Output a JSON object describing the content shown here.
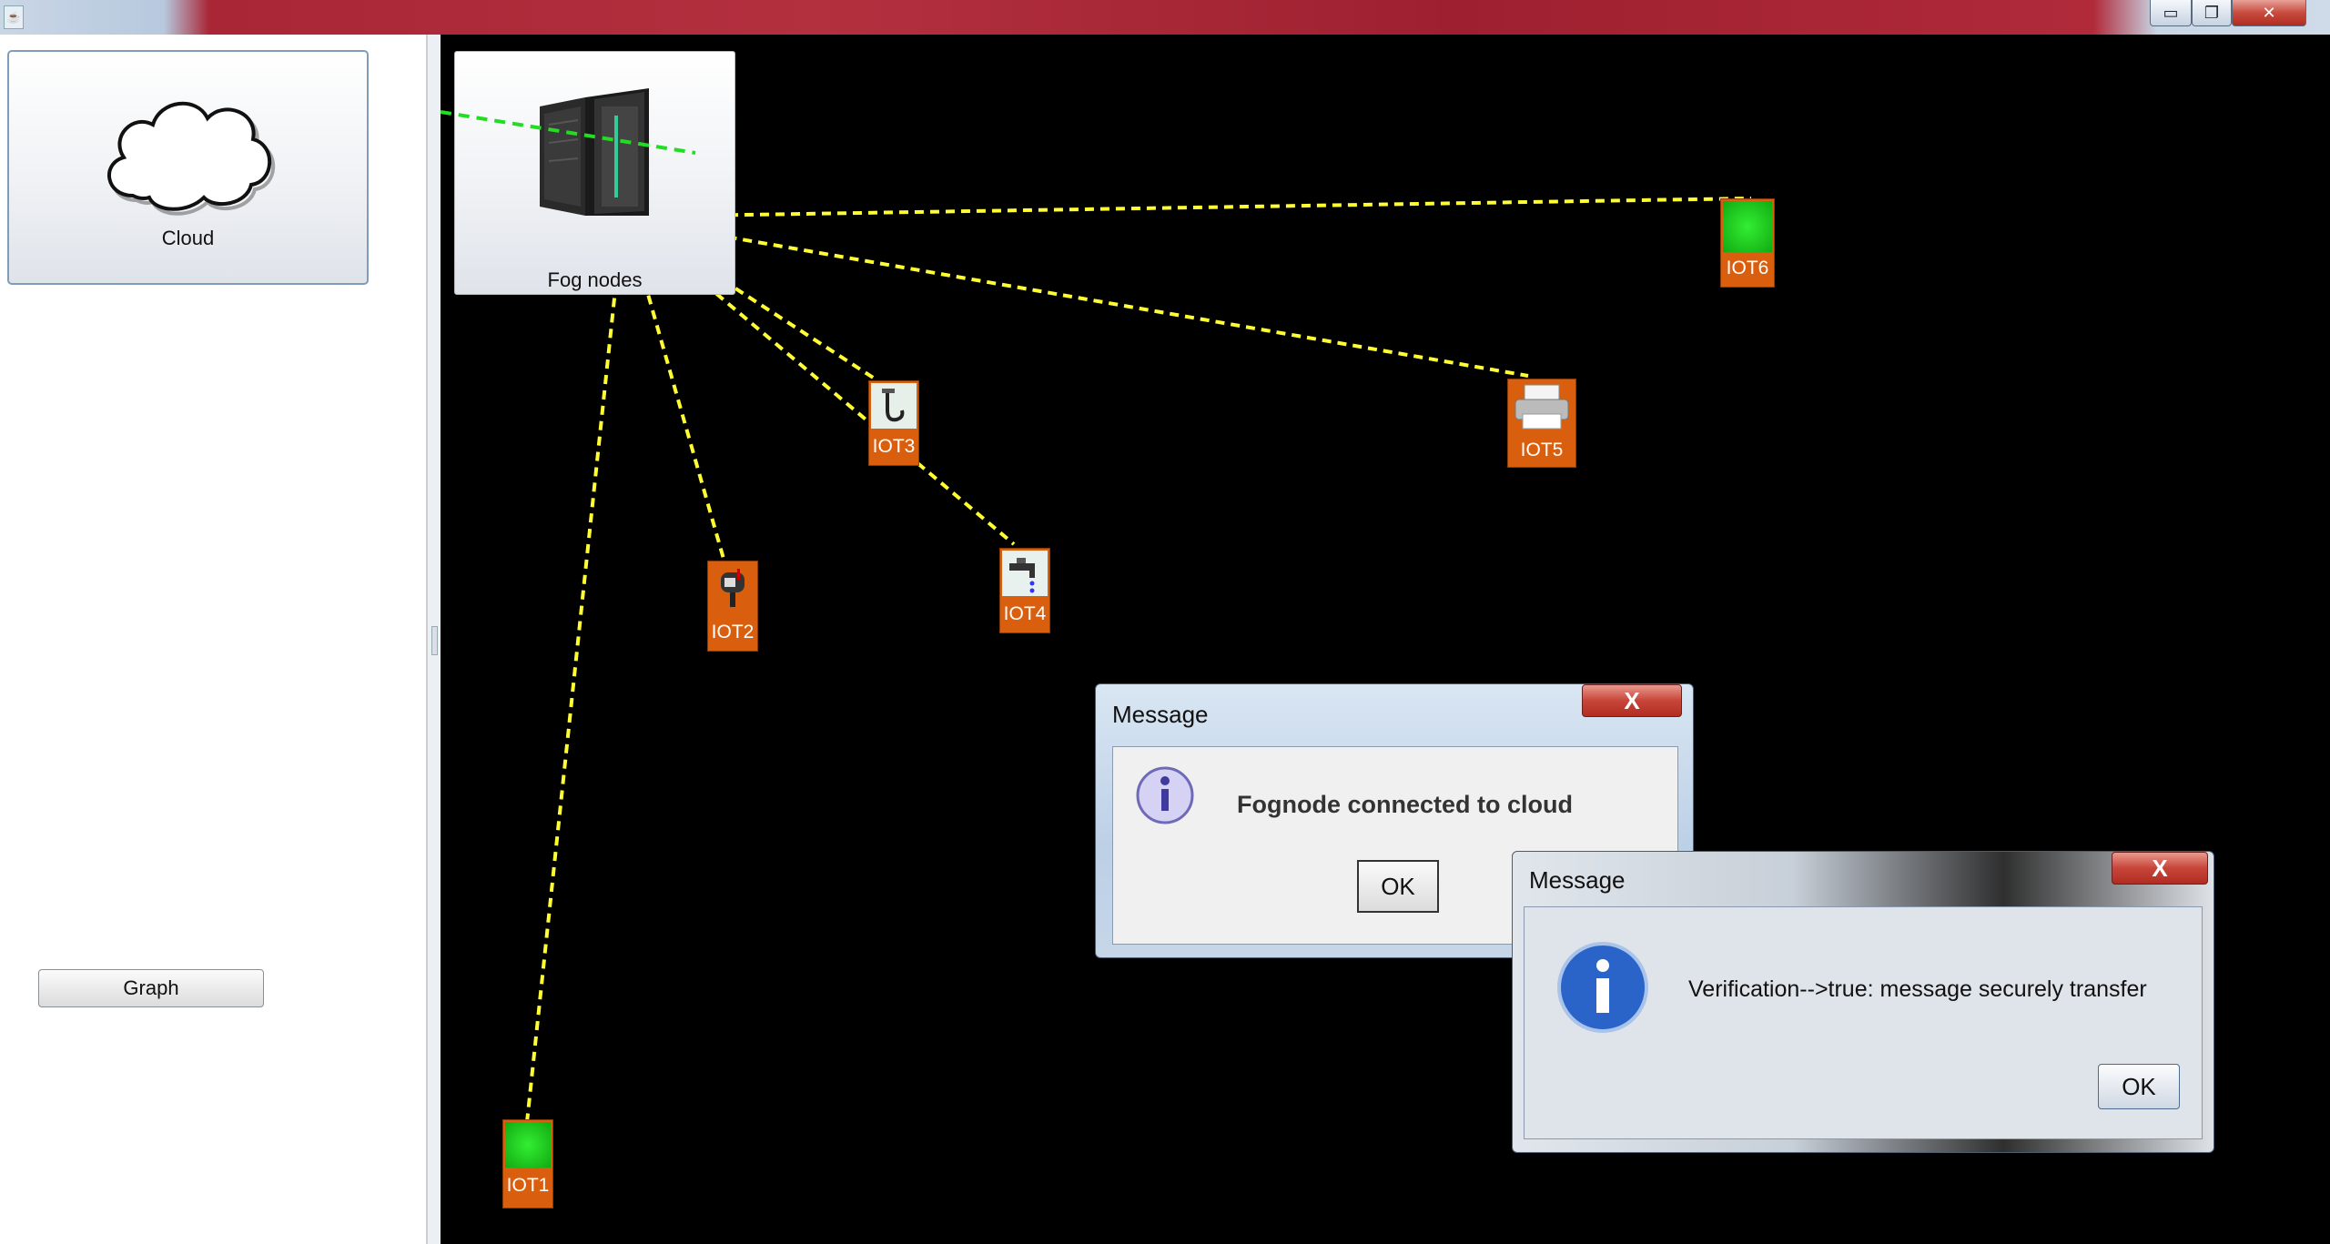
{
  "window": {
    "title": "",
    "controls": {
      "minimize": "▭",
      "restore": "❐",
      "close": "✕"
    }
  },
  "left_panel": {
    "cloud_label": "Cloud",
    "graph_button": "Graph"
  },
  "canvas": {
    "fog_label": "Fog nodes",
    "devices": [
      {
        "label": "IOT1",
        "icon": "green-square-icon"
      },
      {
        "label": "IOT2",
        "icon": "mailbox-icon"
      },
      {
        "label": "IOT3",
        "icon": "faucet-hook-icon"
      },
      {
        "label": "IOT4",
        "icon": "water-tap-icon"
      },
      {
        "label": "IOT5",
        "icon": "printer-icon"
      },
      {
        "label": "IOT6",
        "icon": "green-square-icon"
      }
    ],
    "link_colors": {
      "fog_to_device": "#ffff33",
      "fog_to_cloud": "#22dd22"
    }
  },
  "dialog1": {
    "title": "Message",
    "message": "Fognode connected to cloud",
    "ok": "OK",
    "close": "X",
    "icon": "info-icon"
  },
  "dialog2": {
    "title": "Message",
    "message": "Verification-->true: message securely transfer",
    "ok": "OK",
    "close": "X",
    "icon": "info-icon"
  }
}
